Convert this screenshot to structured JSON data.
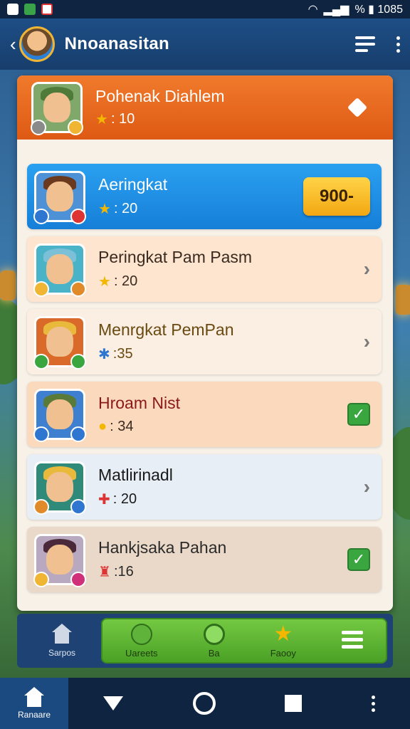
{
  "status_bar": {
    "battery_text": "% ▮ 1085"
  },
  "app_bar": {
    "title": "Nnoanasitan"
  },
  "header_card": {
    "name": "Pohenak Diahlem",
    "score": ": 10"
  },
  "rows": [
    {
      "name": "Aeringkat",
      "score": ": 20",
      "badge": "900-"
    },
    {
      "name": "Peringkat Pam Pasm",
      "score": ": 20"
    },
    {
      "name": "Menrgkat PemPan",
      "score": ":35"
    },
    {
      "name": "Hroam Nist",
      "score": ": 34"
    },
    {
      "name": "Matlirinadl",
      "score": ": 20"
    },
    {
      "name": "Hankjsaka Pahan",
      "score": ":16"
    }
  ],
  "game_nav": {
    "home_label": "Sarpos",
    "tabs": [
      {
        "label": "Uareets"
      },
      {
        "label": "Ba"
      },
      {
        "label": "Faooy"
      }
    ]
  },
  "system_nav": {
    "home_label": "Ranaare"
  },
  "colors": {
    "header_orange": "#e8691e",
    "highlight_blue": "#1e8fe6",
    "accent_green": "#4aa125",
    "row_peach": "#fde5cf",
    "row_light_blue": "#e7eef6",
    "row_tan": "#ead9c8"
  }
}
